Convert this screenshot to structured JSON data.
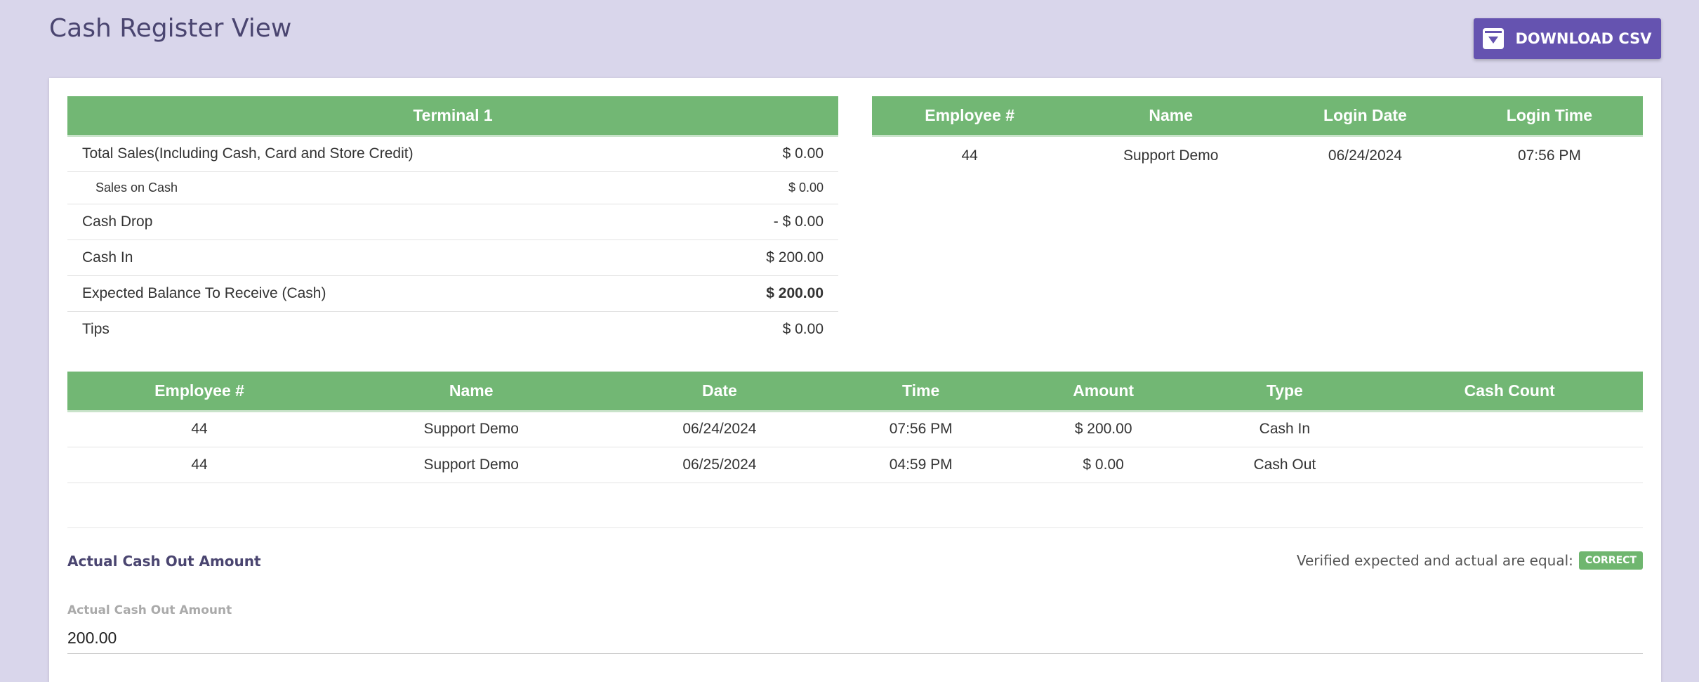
{
  "header": {
    "title": "Cash Register View",
    "download_label": "DOWNLOAD CSV"
  },
  "summary": {
    "title": "Terminal 1",
    "rows": [
      {
        "label": "Total Sales(Including Cash, Card and Store Credit)",
        "value": "$ 0.00"
      },
      {
        "label": "Sales on Cash",
        "value": "$ 0.00"
      },
      {
        "label": "Cash Drop",
        "value": "- $ 0.00"
      },
      {
        "label": "Cash In",
        "value": "$ 200.00"
      },
      {
        "label": "Expected Balance To Receive (Cash)",
        "value": "$ 200.00"
      },
      {
        "label": "Tips",
        "value": "$ 0.00"
      }
    ]
  },
  "login": {
    "headers": [
      "Employee #",
      "Name",
      "Login Date",
      "Login Time"
    ],
    "rows": [
      [
        "44",
        "Support Demo",
        "06/24/2024",
        "07:56 PM"
      ]
    ]
  },
  "transactions": {
    "headers": [
      "Employee #",
      "Name",
      "Date",
      "Time",
      "Amount",
      "Type",
      "Cash Count"
    ],
    "rows": [
      [
        "44",
        "Support Demo",
        "06/24/2024",
        "07:56 PM",
        "$ 200.00",
        "Cash In",
        ""
      ],
      [
        "44",
        "Support Demo",
        "06/25/2024",
        "04:59 PM",
        "$ 0.00",
        "Cash Out",
        ""
      ]
    ]
  },
  "cash_out": {
    "title": "Actual Cash Out Amount",
    "verify_text": "Verified expected and actual are equal:",
    "badge": "CORRECT",
    "field_label": "Actual Cash Out Amount",
    "field_value": "200.00"
  },
  "colors": {
    "background": "#d9d6eb",
    "accent": "#6553b0",
    "table_header": "#72b774",
    "badge": "#6fb66f"
  }
}
